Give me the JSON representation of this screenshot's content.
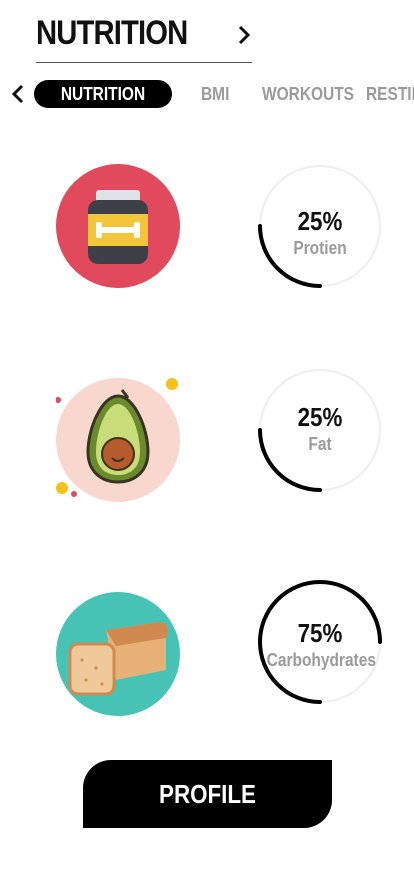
{
  "header": {
    "title": "NUTRITION"
  },
  "tabs": [
    {
      "label": "NUTRITION",
      "active": true
    },
    {
      "label": "BMI",
      "active": false
    },
    {
      "label": "WORKOUTS",
      "active": false
    },
    {
      "label": "RESTING",
      "active": false
    }
  ],
  "nutrients": [
    {
      "icon": "protein-jar-icon",
      "percent": "25%",
      "label": "Protien",
      "progress": 0.25,
      "bg_color": "#e04a5c"
    },
    {
      "icon": "avocado-icon",
      "percent": "25%",
      "label": "Fat",
      "progress": 0.25,
      "bg_color": "#f8d7cf"
    },
    {
      "icon": "bread-icon",
      "percent": "75%",
      "label": "Carbohydrates",
      "progress": 0.75,
      "bg_color": "#47c3b6"
    }
  ],
  "profile_button": {
    "label": "PROFILE"
  },
  "colors": {
    "accent": "#000000",
    "muted": "#9a9a9a",
    "ring_track": "#eeeeee"
  }
}
